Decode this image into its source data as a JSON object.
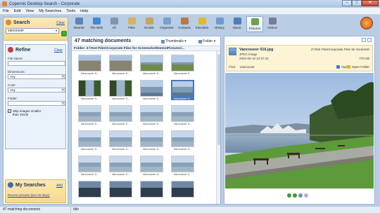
{
  "window": {
    "title": "Copernic Desktop Search - Corporate"
  },
  "menu": [
    "File",
    "Edit",
    "View",
    "My Searches",
    "Tools",
    "Help"
  ],
  "search": {
    "title": "Search",
    "clear": "Clear",
    "query": "vancouver"
  },
  "refine": {
    "title": "Refine",
    "clear": "Clear",
    "filename_label": "File Name:",
    "filename_value": "",
    "dimensions_label": "Dimensions:",
    "dimensions_value": "Any",
    "color_label": "Color:",
    "color_value": "Any",
    "folder_label": "Folder:",
    "folder_value": "",
    "skip_line1": "Skip images smaller",
    "skip_line2": "than 32x32",
    "skip_checked": true
  },
  "my_searches": {
    "title": "My Searches",
    "add": "Add",
    "recent": "Recent pictures (last 30 days)"
  },
  "toolbar": [
    {
      "label": "Intranet",
      "icon": "intranet-icon",
      "color": "#5c86b8"
    },
    {
      "label": "The Web",
      "icon": "globe-icon",
      "color": "#3f8ad1"
    },
    {
      "label": "All",
      "icon": "all-icon",
      "color": "#7c95b5"
    },
    {
      "label": "Files",
      "icon": "files-icon",
      "color": "#d9b356"
    },
    {
      "label": "Emails",
      "icon": "email-icon",
      "color": "#c8a45a"
    },
    {
      "label": "Organizer",
      "icon": "organizer-icon",
      "color": "#7aa0c9"
    },
    {
      "label": "Contacts",
      "icon": "contacts-icon",
      "color": "#b87a4a"
    },
    {
      "label": "Favorites",
      "icon": "favorites-icon",
      "color": "#e0b92a"
    },
    {
      "label": "History",
      "icon": "history-icon",
      "color": "#6f9bd1"
    },
    {
      "label": "Music",
      "icon": "music-icon",
      "color": "#4f7fb8"
    },
    {
      "label": "Pictures",
      "icon": "pictures-icon",
      "color": "#6aa44a",
      "active": true
    },
    {
      "label": "Videos",
      "icon": "videos-icon",
      "color": "#7a7a9a"
    }
  ],
  "results": {
    "count": "47 matching documents",
    "view": "Thumbnails",
    "sort": "Folder",
    "folder": "Folder: Z:\\Test Files\\Corporate Files for Screenshot\\Demo\\Pictures\\..."
  },
  "thumbnails": [
    {
      "caption": "Vancouver 0...",
      "kind": "rocks"
    },
    {
      "caption": "Vancouver 0...",
      "kind": "rocks"
    },
    {
      "caption": "Vancouver 0...",
      "kind": "shore"
    },
    {
      "caption": "Vancouver 0...",
      "kind": "shore"
    },
    {
      "caption": "Vancouver 0...",
      "kind": "tree"
    },
    {
      "caption": "Vancouver 0...",
      "kind": "tree"
    },
    {
      "caption": "Vancouver 0...",
      "kind": "water"
    },
    {
      "caption": "Vancouver 0...",
      "kind": "water",
      "selected": true
    },
    {
      "caption": "Vancouver 0...",
      "kind": "sea"
    },
    {
      "caption": "Vancouver 0...",
      "kind": "sea"
    },
    {
      "caption": "Vancouver 0...",
      "kind": "sea"
    },
    {
      "caption": "Vancouver 0...",
      "kind": "sea"
    },
    {
      "caption": "Vancouver 0...",
      "kind": "sea"
    },
    {
      "caption": "Vancouver 0...",
      "kind": "sea"
    },
    {
      "caption": "Vancouver 0...",
      "kind": "sea"
    },
    {
      "caption": "Vancouver 0...",
      "kind": "sea"
    },
    {
      "caption": "Vancouver 0...",
      "kind": "sea"
    },
    {
      "caption": "Vancouver 0...",
      "kind": "sea"
    },
    {
      "caption": "Vancouver 0...",
      "kind": "sea"
    },
    {
      "caption": "Vancouver 0...",
      "kind": "sea"
    },
    {
      "caption": "",
      "kind": "dark"
    },
    {
      "caption": "",
      "kind": "dark"
    },
    {
      "caption": "",
      "kind": "dark"
    },
    {
      "caption": "",
      "kind": "dark"
    }
  ],
  "preview": {
    "name": "Vancouver 016.jpg",
    "type": "JPEG Image",
    "date": "2003-06-16 22:57:22",
    "path": "Z:\\Test Files\\Corporate Files for Screensh",
    "size": "770 KB",
    "find_label": "Find:",
    "find_value": "vancouver",
    "open": "Open",
    "open_folder": "Open Folder"
  },
  "status": {
    "left": "47 matching documents",
    "right": "Idle"
  }
}
